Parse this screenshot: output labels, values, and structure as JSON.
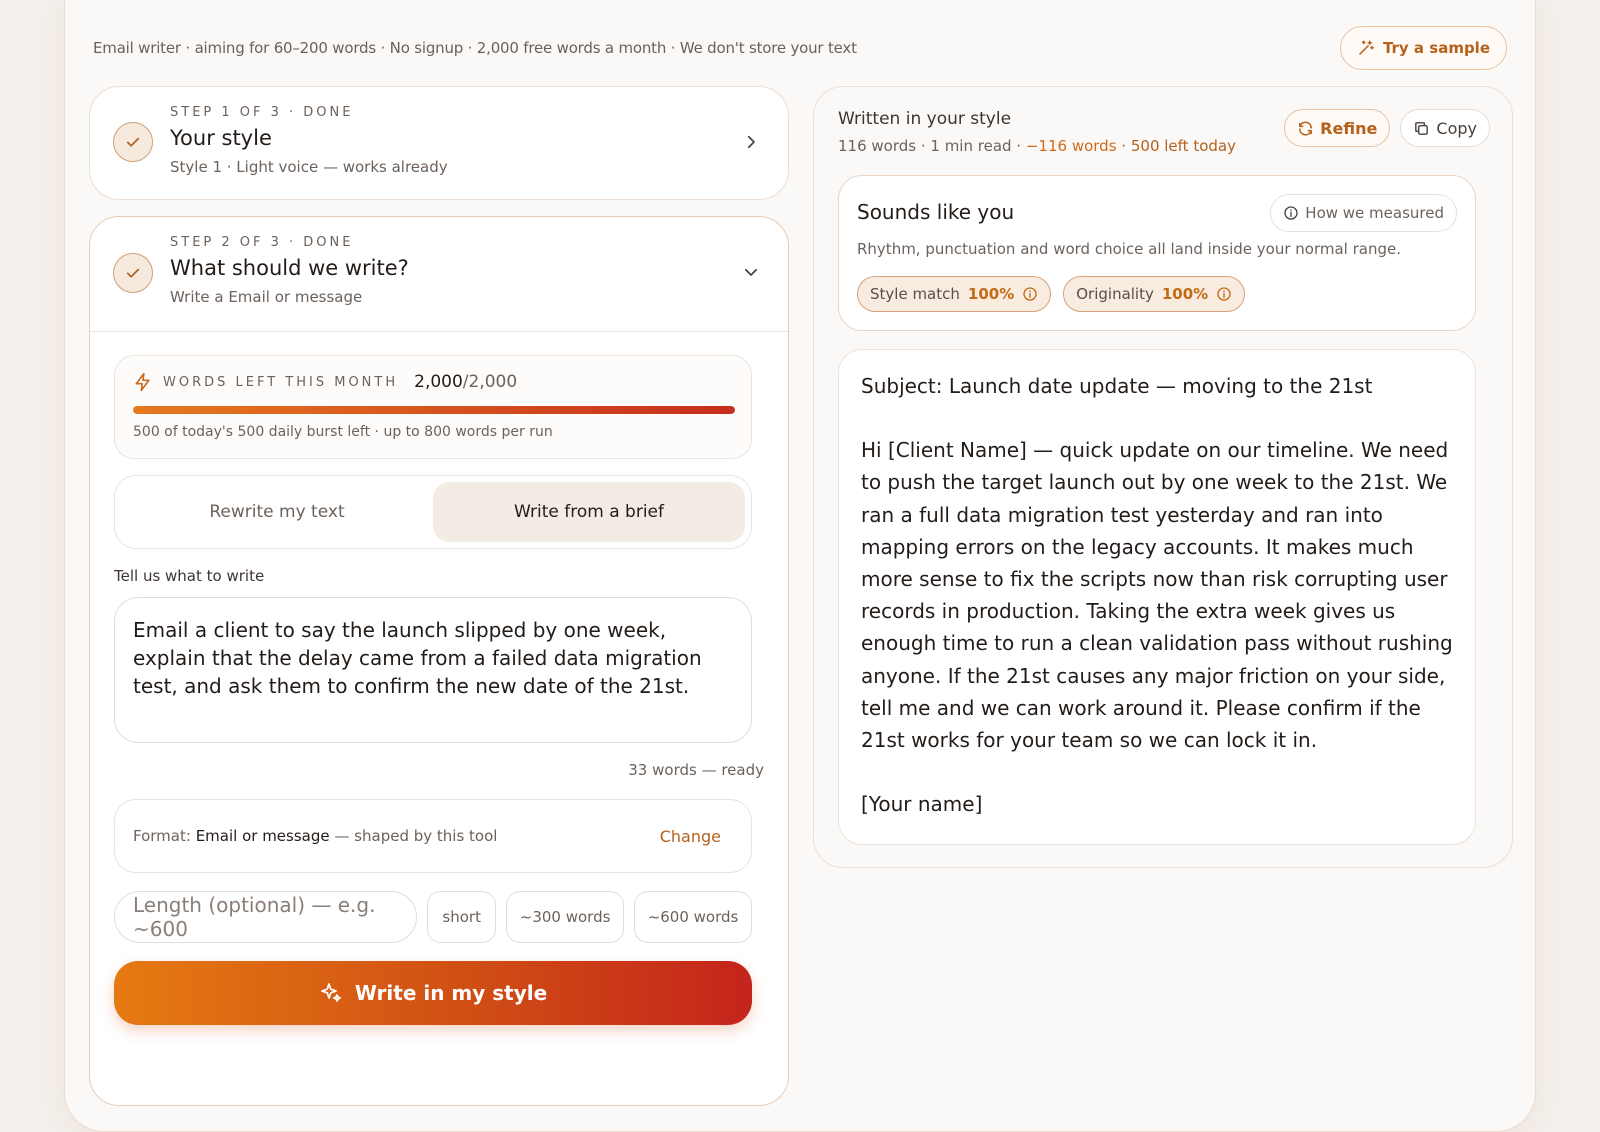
{
  "header": {
    "tagline": "Email writer · aiming for 60–200 words · No signup · 2,000 free words a month · We don't store your text",
    "try_sample": "Try a sample",
    "try_sample_icon": "magic-wand-icon"
  },
  "step1": {
    "kicker": "STEP 1 OF 3 · DONE",
    "title": "Your style",
    "subtitle": "Style 1 · Light voice — works already"
  },
  "step2": {
    "kicker": "STEP 2 OF 3 · DONE",
    "title": "What should we write?",
    "subtitle": "Write a Email or message",
    "words": {
      "kicker": "WORDS LEFT THIS MONTH",
      "count": "2,000",
      "total": "/2,000",
      "fraction_left": 1.0,
      "note": "500 of today's 500 daily burst left · up to 800 words per run"
    },
    "mode": {
      "options": [
        "Rewrite my text",
        "Write from a brief"
      ],
      "selected": "Write from a brief"
    },
    "brief_label": "Tell us what to write",
    "brief_text": "Email a client to say the launch slipped by one week, explain that the delay came from a failed data migration test, and ask them to confirm the new date of the 21st.",
    "brief_count": "33 words — ready",
    "format": {
      "prefix": "Format:",
      "value": "Email or message",
      "suffix": "— shaped by this tool",
      "change": "Change"
    },
    "length": {
      "placeholder": "Length (optional) — e.g. ~600",
      "chips": [
        "short",
        "~300 words",
        "~600 words"
      ]
    },
    "submit": "Write in my style"
  },
  "output": {
    "title": "Written in your style",
    "meta_words": "116 words · 1 min read ·",
    "meta_delta": "−116 words",
    "meta_sep": "·",
    "meta_left": "500 left today",
    "refine": "Refine",
    "copy": "Copy",
    "sounds": {
      "title": "Sounds like you",
      "how": "How we measured",
      "desc": "Rhythm, punctuation and word choice all land inside your normal range.",
      "style_label": "Style match",
      "style_value": "100%",
      "orig_label": "Originality",
      "orig_value": "100%"
    },
    "subject": "Subject: Launch date update — moving to the 21st",
    "body": "Hi [Client Name] — quick update on our timeline. We need to push the target launch out by one week to the 21st. We ran a full data migration test yesterday and ran into mapping errors on the legacy accounts. It makes much more sense to fix the scripts now than risk corrupting user records in production. Taking the extra week gives us enough time to run a clean validation pass without rushing anyone. If the 21st causes any major friction on your side, tell me and we can work around it. Please confirm if the 21st works for your team so we can lock it in.",
    "signoff": "[Your name]"
  },
  "colors": {
    "accent": "#b4611c",
    "gradient_start": "#e67a12",
    "gradient_end": "#c4241c"
  }
}
